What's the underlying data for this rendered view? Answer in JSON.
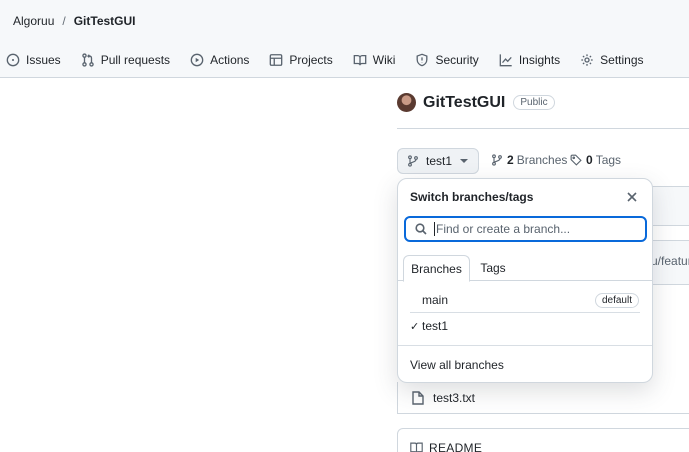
{
  "breadcrumb": {
    "owner": "Algoruu",
    "separator": "/",
    "repo": "GitTestGUI"
  },
  "nav": [
    {
      "label": "Issues",
      "icon": "issue-circle-icon"
    },
    {
      "label": "Pull requests",
      "icon": "git-pull-request-icon"
    },
    {
      "label": "Actions",
      "icon": "play-circle-icon"
    },
    {
      "label": "Projects",
      "icon": "table-icon"
    },
    {
      "label": "Wiki",
      "icon": "book-icon"
    },
    {
      "label": "Security",
      "icon": "shield-icon"
    },
    {
      "label": "Insights",
      "icon": "graph-icon"
    },
    {
      "label": "Settings",
      "icon": "gear-icon"
    }
  ],
  "repo": {
    "name": "GitTestGUI",
    "visibility": "Public"
  },
  "branch_button": {
    "label": "test1"
  },
  "counts": {
    "branches_num": "2",
    "branches_label": "Branches",
    "tags_num": "0",
    "tags_label": "Tags"
  },
  "dropdown": {
    "title": "Switch branches/tags",
    "search_placeholder": "Find or create a branch...",
    "tabs": [
      "Branches",
      "Tags"
    ],
    "active_tab": "Branches",
    "branches": [
      {
        "name": "main",
        "badge": "default",
        "selected": false
      },
      {
        "name": "test1",
        "badge": "",
        "selected": true
      }
    ],
    "footer_link": "View all branches"
  },
  "background": {
    "partial_text": "u/featur",
    "file_name": "test3.txt",
    "readme_label": "README"
  },
  "colors": {
    "accent": "#0969da",
    "border": "#d0d7de",
    "header_bg": "#f6f8fa"
  }
}
